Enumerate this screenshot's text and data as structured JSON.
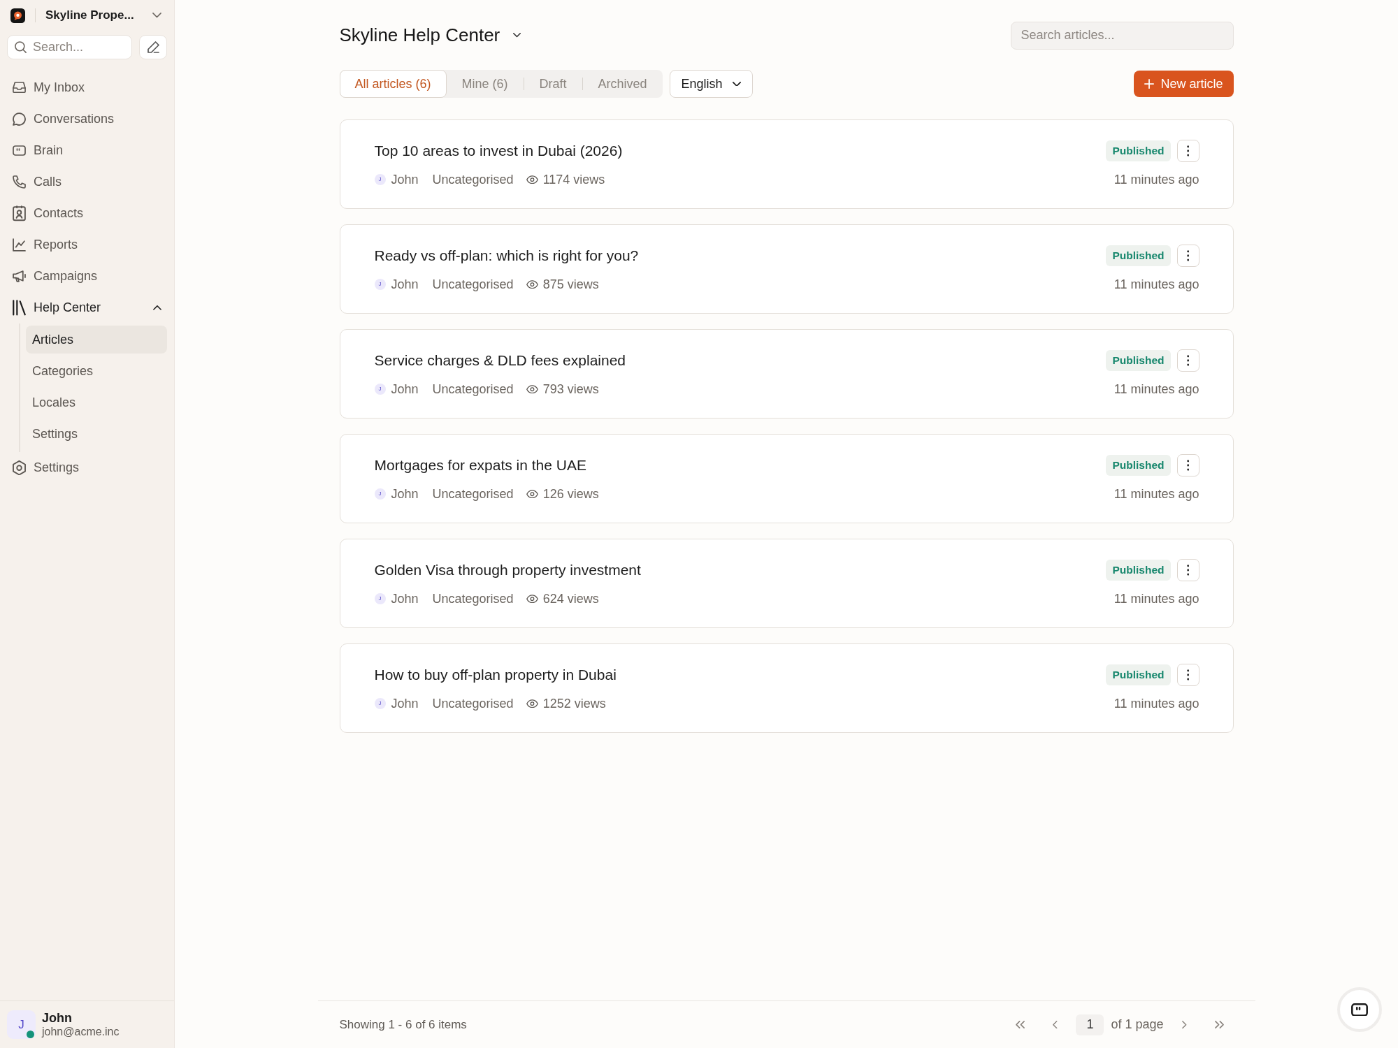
{
  "sidebar": {
    "workspace": {
      "name": "Skyline Prope..."
    },
    "search": {
      "placeholder": "Search..."
    },
    "nav": [
      {
        "label": "My Inbox",
        "selected": false
      },
      {
        "label": "Conversations",
        "selected": false
      },
      {
        "label": "Brain",
        "selected": false
      },
      {
        "label": "Calls",
        "selected": false
      },
      {
        "label": "Contacts",
        "selected": false
      },
      {
        "label": "Reports",
        "selected": false
      },
      {
        "label": "Campaigns",
        "selected": false
      },
      {
        "label": "Help Center",
        "selected": false,
        "expanded": true,
        "children": [
          {
            "label": "Articles",
            "selected": true
          },
          {
            "label": "Categories",
            "selected": false
          },
          {
            "label": "Locales",
            "selected": false
          },
          {
            "label": "Settings",
            "selected": false
          }
        ]
      },
      {
        "label": "Settings",
        "selected": false
      }
    ],
    "user": {
      "initial": "J",
      "name": "John",
      "email": "john@acme.inc",
      "online": true
    }
  },
  "header": {
    "title": "Skyline Help Center",
    "search": {
      "placeholder": "Search articles..."
    }
  },
  "tabs": [
    {
      "label": "All articles (6)",
      "selected": true
    },
    {
      "label": "Mine (6)",
      "selected": false
    },
    {
      "label": "Draft",
      "selected": false
    },
    {
      "label": "Archived",
      "selected": false
    }
  ],
  "language": {
    "value": "English"
  },
  "new_article_button": {
    "label": "New article"
  },
  "articles": [
    {
      "title": "Top 10 areas to invest in Dubai (2026)",
      "author": {
        "initial": "J",
        "name": "John"
      },
      "category": "Uncategorised",
      "views": "1174 views",
      "status": "Published",
      "updated": "11 minutes ago"
    },
    {
      "title": "Ready vs off-plan: which is right for you?",
      "author": {
        "initial": "J",
        "name": "John"
      },
      "category": "Uncategorised",
      "views": "875 views",
      "status": "Published",
      "updated": "11 minutes ago"
    },
    {
      "title": "Service charges & DLD fees explained",
      "author": {
        "initial": "J",
        "name": "John"
      },
      "category": "Uncategorised",
      "views": "793 views",
      "status": "Published",
      "updated": "11 minutes ago"
    },
    {
      "title": "Mortgages for expats in the UAE",
      "author": {
        "initial": "J",
        "name": "John"
      },
      "category": "Uncategorised",
      "views": "126 views",
      "status": "Published",
      "updated": "11 minutes ago"
    },
    {
      "title": "Golden Visa through property investment",
      "author": {
        "initial": "J",
        "name": "John"
      },
      "category": "Uncategorised",
      "views": "624 views",
      "status": "Published",
      "updated": "11 minutes ago"
    },
    {
      "title": "How to buy off-plan property in Dubai",
      "author": {
        "initial": "J",
        "name": "John"
      },
      "category": "Uncategorised",
      "views": "1252 views",
      "status": "Published",
      "updated": "11 minutes ago"
    }
  ],
  "footer": {
    "summary": "Showing 1 - 6 of 6 items",
    "page": "1",
    "page_total": "of 1 page"
  }
}
